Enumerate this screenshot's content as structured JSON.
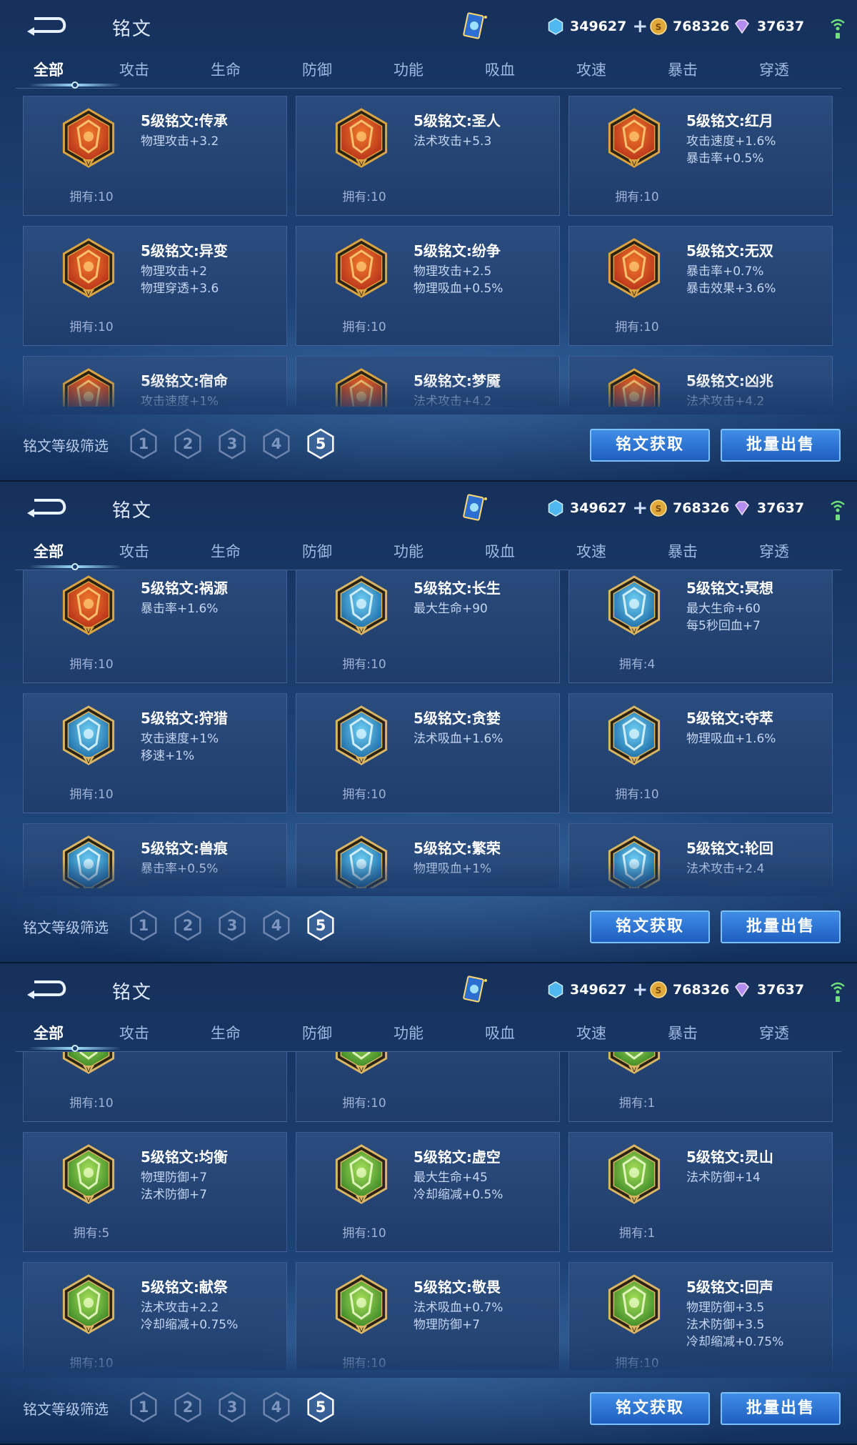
{
  "header": {
    "title": "铭文",
    "resources": [
      {
        "icon": "diamond-icon",
        "value": "349627"
      },
      {
        "icon": "gold-coin-icon",
        "value": "768326"
      },
      {
        "icon": "purple-gem-icon",
        "value": "37637"
      }
    ]
  },
  "tabs": [
    "全部",
    "攻击",
    "生命",
    "防御",
    "功能",
    "吸血",
    "攻速",
    "暴击",
    "穿透"
  ],
  "filter": {
    "label": "铭文等级筛选",
    "levels": [
      "1",
      "2",
      "3",
      "4",
      "5"
    ],
    "selected": "5"
  },
  "buttons": {
    "get": "铭文获取",
    "sell": "批量出售"
  },
  "colors": {
    "red_rune": "#d9521c",
    "blue_rune": "#3aa6d8",
    "green_rune": "#6db83a",
    "accent": "#3f8de6"
  },
  "panels": [
    {
      "cards": [
        {
          "name": "5级铭文:传承",
          "stats": [
            "物理攻击+3.2"
          ],
          "owned": "拥有:10",
          "color": "red"
        },
        {
          "name": "5级铭文:圣人",
          "stats": [
            "法术攻击+5.3"
          ],
          "owned": "拥有:10",
          "color": "red"
        },
        {
          "name": "5级铭文:红月",
          "stats": [
            "攻击速度+1.6%",
            "暴击率+0.5%"
          ],
          "owned": "拥有:10",
          "color": "red"
        },
        {
          "name": "5级铭文:异变",
          "stats": [
            "物理攻击+2",
            "物理穿透+3.6"
          ],
          "owned": "拥有:10",
          "color": "red"
        },
        {
          "name": "5级铭文:纷争",
          "stats": [
            "物理攻击+2.5",
            "物理吸血+0.5%"
          ],
          "owned": "拥有:10",
          "color": "red"
        },
        {
          "name": "5级铭文:无双",
          "stats": [
            "暴击率+0.7%",
            "暴击效果+3.6%"
          ],
          "owned": "拥有:10",
          "color": "red"
        },
        {
          "name": "5级铭文:宿命",
          "stats": [
            "攻击速度+1%"
          ],
          "owned": "",
          "color": "red"
        },
        {
          "name": "5级铭文:梦魇",
          "stats": [
            "法术攻击+4.2"
          ],
          "owned": "",
          "color": "red"
        },
        {
          "name": "5级铭文:凶兆",
          "stats": [
            "法术攻击+4.2"
          ],
          "owned": "",
          "color": "red"
        }
      ]
    },
    {
      "cards": [
        {
          "name": "5级铭文:祸源",
          "stats": [
            "暴击率+1.6%"
          ],
          "owned": "拥有:10",
          "color": "red"
        },
        {
          "name": "5级铭文:长生",
          "stats": [
            "最大生命+90"
          ],
          "owned": "拥有:10",
          "color": "blue"
        },
        {
          "name": "5级铭文:冥想",
          "stats": [
            "最大生命+60",
            "每5秒回血+7"
          ],
          "owned": "拥有:4",
          "color": "blue"
        },
        {
          "name": "5级铭文:狩猎",
          "stats": [
            "攻击速度+1%",
            "移速+1%"
          ],
          "owned": "拥有:10",
          "color": "blue"
        },
        {
          "name": "5级铭文:贪婪",
          "stats": [
            "法术吸血+1.6%"
          ],
          "owned": "拥有:10",
          "color": "blue"
        },
        {
          "name": "5级铭文:夺萃",
          "stats": [
            "物理吸血+1.6%"
          ],
          "owned": "拥有:10",
          "color": "blue"
        },
        {
          "name": "5级铭文:兽痕",
          "stats": [
            "暴击率+0.5%"
          ],
          "owned": "",
          "color": "blue"
        },
        {
          "name": "5级铭文:繁荣",
          "stats": [
            "物理吸血+1%"
          ],
          "owned": "",
          "color": "blue"
        },
        {
          "name": "5级铭文:轮回",
          "stats": [
            "法术攻击+2.4"
          ],
          "owned": "",
          "color": "blue"
        }
      ]
    },
    {
      "cards": [
        {
          "name": "",
          "stats": [],
          "owned": "拥有:10",
          "color": "green"
        },
        {
          "name": "",
          "stats": [],
          "owned": "拥有:10",
          "color": "green"
        },
        {
          "name": "",
          "stats": [],
          "owned": "拥有:1",
          "color": "green"
        },
        {
          "name": "5级铭文:均衡",
          "stats": [
            "物理防御+7",
            "法术防御+7"
          ],
          "owned": "拥有:5",
          "color": "green"
        },
        {
          "name": "5级铭文:虚空",
          "stats": [
            "最大生命+45",
            "冷却缩减+0.5%"
          ],
          "owned": "拥有:10",
          "color": "green"
        },
        {
          "name": "5级铭文:灵山",
          "stats": [
            "法术防御+14"
          ],
          "owned": "拥有:1",
          "color": "green"
        },
        {
          "name": "5级铭文:献祭",
          "stats": [
            "法术攻击+2.2",
            "冷却缩减+0.75%"
          ],
          "owned": "拥有:10",
          "color": "green"
        },
        {
          "name": "5级铭文:敬畏",
          "stats": [
            "法术吸血+0.7%",
            "物理防御+7"
          ],
          "owned": "拥有:10",
          "color": "green"
        },
        {
          "name": "5级铭文:回声",
          "stats": [
            "物理防御+3.5",
            "法术防御+3.5",
            "冷却缩减+0.75%"
          ],
          "owned": "拥有:10",
          "color": "green"
        }
      ]
    }
  ]
}
